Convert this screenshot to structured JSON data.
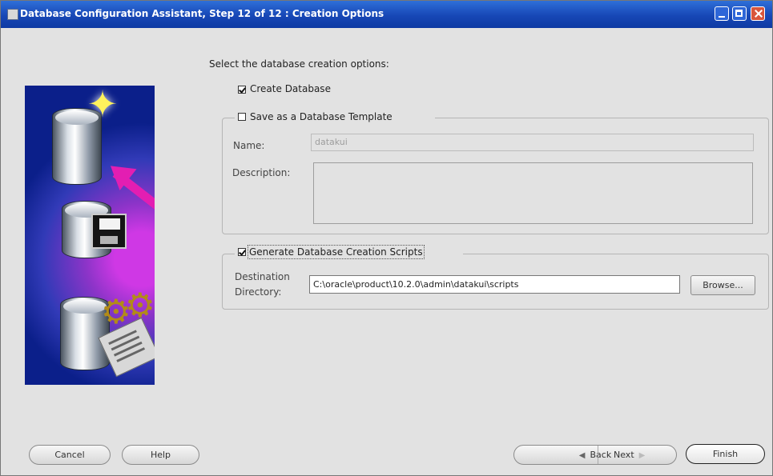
{
  "window": {
    "title": "Database Configuration Assistant, Step 12 of 12 : Creation Options"
  },
  "content": {
    "prompt": "Select the database creation options:",
    "create_database": {
      "label": "Create Database",
      "checked": true
    },
    "save_template": {
      "label": "Save as a Database Template",
      "checked": false,
      "name_label": "Name:",
      "name_value": "datakui",
      "description_label": "Description:",
      "description_value": ""
    },
    "generate_scripts": {
      "label": "Generate Database Creation Scripts",
      "checked": true,
      "destination_label_1": "Destination",
      "destination_label_2": "Directory:",
      "destination_value": "C:\\oracle\\product\\10.2.0\\admin\\datakui\\scripts",
      "browse_label": "Browse..."
    }
  },
  "footer": {
    "cancel_label": "Cancel",
    "help_label": "Help",
    "back_label": "Back",
    "next_label": "Next",
    "finish_label": "Finish"
  },
  "icons": {
    "window_icon": "database-icon",
    "back_icon": "chevron-left-icon",
    "next_icon": "chevron-right-icon",
    "art_database": "database-icon",
    "art_floppy": "floppy-disk-icon",
    "art_gear": "gear-icon"
  },
  "colors": {
    "titlebar": "#1747b6",
    "art_background": "#313ab7",
    "arrow": "#e31eb2"
  }
}
